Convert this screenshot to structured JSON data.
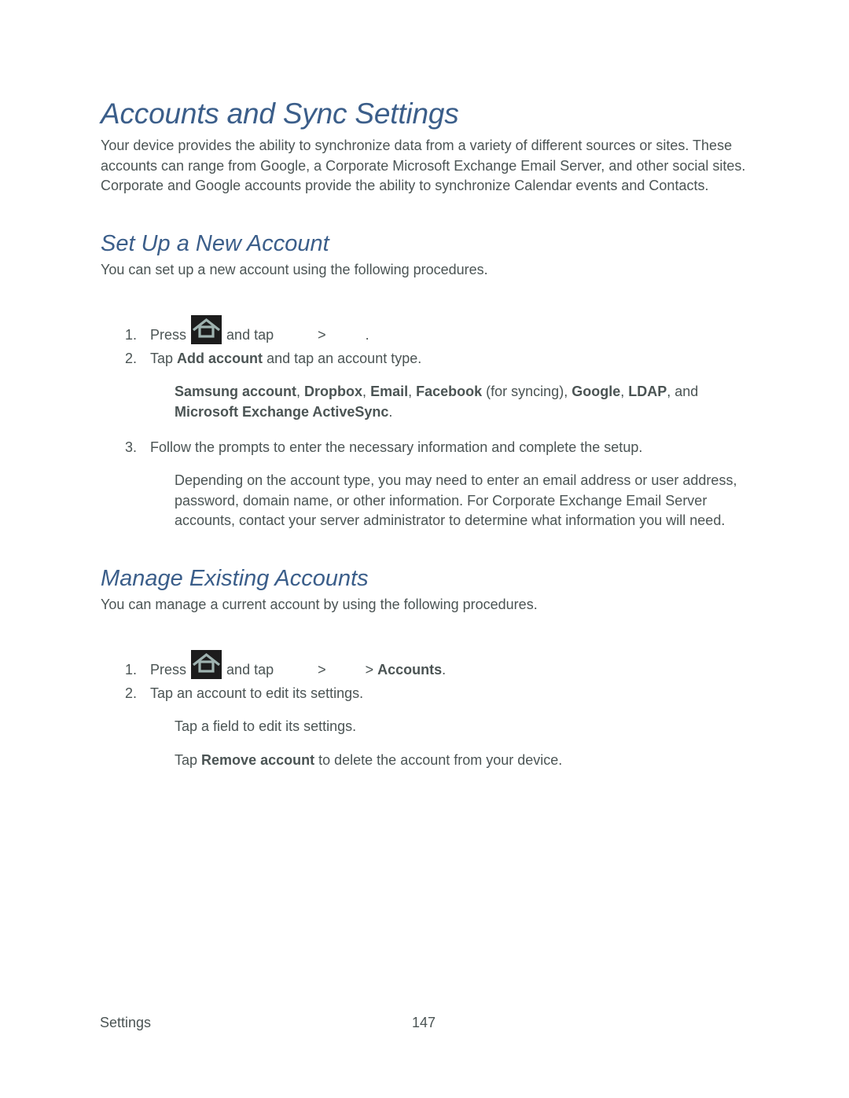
{
  "page": {
    "title": "Accounts and Sync Settings",
    "intro": "Your device provides the ability to synchronize data from a variety of different sources or sites. These accounts can range from Google, a Corporate Microsoft Exchange Email Server, and other social sites. Corporate and Google accounts provide the ability to synchronize Calendar events and Contacts."
  },
  "setup_section": {
    "heading": "Set Up a New Account",
    "intro": "You can set up a new account using the following procedures.",
    "steps": [
      {
        "num": "1.",
        "press": "Press",
        "icon": "home-icon",
        "and_tap": "and tap",
        "sep1": ">",
        "end": "."
      },
      {
        "num": "2.",
        "pre": "Tap",
        "bold": "Add account",
        "post": "and tap an account type."
      },
      {
        "num": "3.",
        "text": "Follow the prompts to enter the necessary information and complete the setup."
      }
    ],
    "account_types": {
      "items": [
        "Samsung account",
        "Dropbox",
        "Email",
        "Facebook",
        "Google",
        "LDAP",
        "Microsoft Exchange ActiveSync"
      ],
      "facebook_note": "(for syncing)",
      "and": "and"
    },
    "step3_note": "Depending on the account type, you may need to enter an email address or user address, password, domain name, or other information. For Corporate Exchange Email Server accounts, contact your server administrator to determine what information you will need."
  },
  "manage_section": {
    "heading": "Manage Existing Accounts",
    "intro": "You can manage a current account by using the following procedures.",
    "steps": [
      {
        "num": "1.",
        "press": "Press",
        "icon": "home-icon",
        "and_tap": "and tap",
        "sep1": ">",
        "sep2": ">",
        "bold": "Accounts",
        "end": "."
      },
      {
        "num": "2.",
        "text": "Tap an account to edit its settings."
      }
    ],
    "notes": [
      {
        "text": "Tap a field to edit its settings."
      },
      {
        "pre": "Tap",
        "bold": "Remove account",
        "post": "to delete the account from your device."
      }
    ]
  },
  "footer": {
    "section": "Settings",
    "page_number": "147"
  },
  "colors": {
    "heading": "#3b5e8a",
    "body_text": "#4b5454",
    "icon_bg": "#1c1c1c",
    "icon_fg": "#9fb3b0"
  }
}
